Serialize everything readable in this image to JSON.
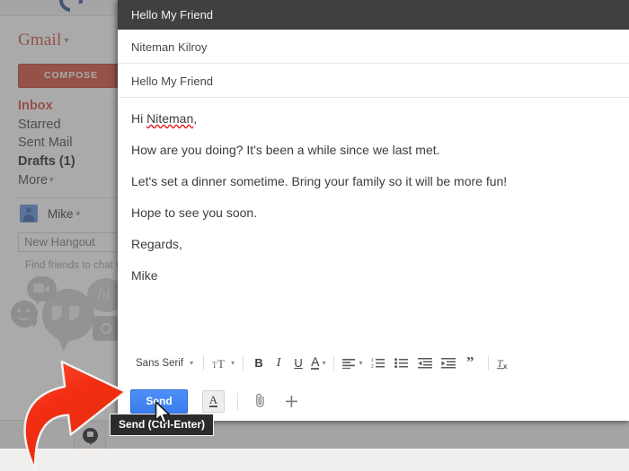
{
  "app": {
    "name": "Gmail",
    "logo_text": "Gmail",
    "caret": "▾"
  },
  "sidebar": {
    "compose_label": "COMPOSE",
    "nav_items": [
      {
        "label": "Inbox",
        "style": "active"
      },
      {
        "label": "Starred",
        "style": "normal"
      },
      {
        "label": "Sent Mail",
        "style": "normal"
      },
      {
        "label": "Drafts (1)",
        "style": "bold"
      },
      {
        "label": "More",
        "style": "normal",
        "caret": "▾"
      }
    ],
    "hangouts": {
      "user_name": "Mike",
      "user_caret": "▾",
      "new_hangout_value": "New Hangout",
      "hint_text": "Find friends to chat w"
    }
  },
  "compose": {
    "header_title": "Hello My Friend",
    "recipient": "Niteman Kilroy",
    "subject": "Hello My Friend",
    "body": {
      "greeting_prefix": "Hi ",
      "greeting_name": "Niteman",
      "greeting_suffix": ",",
      "line_2": "How are you doing? It's been a while since we last met.",
      "line_3": "Let's set a dinner sometime. Bring your family so it will be more fun!",
      "line_4": "Hope to see you soon.",
      "line_5": "Regards,",
      "line_6": "Mike"
    },
    "format_toolbar": {
      "font_family_label": "Sans Serif",
      "font_family_caret": "▾",
      "font_size_caret": "▾",
      "bold_label": "B",
      "italic_label": "I",
      "underline_label": "U",
      "text_color_label": "A",
      "text_color_caret": "▾",
      "align_caret": "▾",
      "items": [
        "font-family-selector",
        "font-size-button",
        "bold-button",
        "italic-button",
        "underline-button",
        "text-color-button",
        "align-button",
        "numbered-list-button",
        "bulleted-list-button",
        "indent-less-button",
        "indent-more-button",
        "quote-button",
        "remove-formatting-button"
      ]
    },
    "actions": {
      "send_label": "Send",
      "formatting_toggle_label": "A",
      "attach_icon": "paperclip-icon",
      "insert_icon": "plus-icon"
    }
  },
  "tooltip": {
    "text": "Send (Ctrl-Enter)"
  },
  "annotation": {
    "arrow_color": "#f0361f",
    "arrow_points_to": "send-button"
  },
  "colors": {
    "gmail_red": "#d14836",
    "send_blue": "#4285f4",
    "compose_header_dark": "#404040",
    "tooltip_dark": "#2b2b2b",
    "dim_overlay": "rgba(92,92,92,0.52)"
  }
}
